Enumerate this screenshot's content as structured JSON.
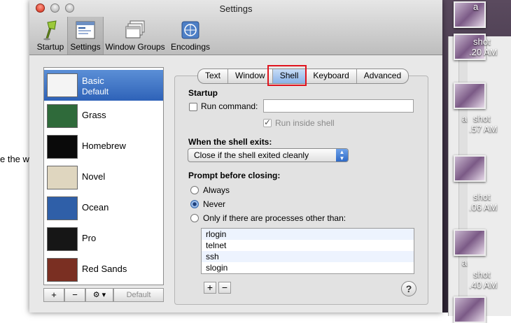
{
  "background": {
    "text": "e the w"
  },
  "desktop": {
    "labels": [
      {
        "line1": "shot",
        "line2": ".20 AM"
      },
      {
        "line1": "shot",
        "line2": ".57 AM"
      },
      {
        "line1": "shot",
        "line2": ".06 AM"
      },
      {
        "line1": "shot",
        "line2": ".40 AM"
      }
    ],
    "partial_1": "a",
    "partial_2": "a",
    "partial_3": "a"
  },
  "window": {
    "title": "Settings",
    "toolbar": [
      {
        "label": "Startup",
        "icon": "startup-icon"
      },
      {
        "label": "Settings",
        "icon": "settings-icon"
      },
      {
        "label": "Window Groups",
        "icon": "window-groups-icon"
      },
      {
        "label": "Encodings",
        "icon": "encodings-icon"
      }
    ]
  },
  "profiles": [
    {
      "name": "Basic",
      "sub": "Default"
    },
    {
      "name": "Grass"
    },
    {
      "name": "Homebrew"
    },
    {
      "name": "Novel"
    },
    {
      "name": "Ocean"
    },
    {
      "name": "Pro"
    },
    {
      "name": "Red Sands"
    }
  ],
  "profile_buttons": {
    "add": "+",
    "remove": "−",
    "action": "⚙ ▾",
    "default": "Default"
  },
  "tabs": [
    "Text",
    "Window",
    "Shell",
    "Keyboard",
    "Advanced"
  ],
  "shell": {
    "startup_heading": "Startup",
    "run_command_label": "Run command:",
    "run_command_value": "",
    "run_inside_shell_label": "Run inside shell",
    "exit_heading": "When the shell exits:",
    "exit_selected": "Close if the shell exited cleanly",
    "prompt_heading": "Prompt before closing:",
    "radio_always": "Always",
    "radio_never": "Never",
    "radio_only_if": "Only if there are processes other than:",
    "processes": [
      "rlogin",
      "telnet",
      "ssh",
      "slogin"
    ],
    "add": "+",
    "remove": "−",
    "help": "?"
  },
  "colors": {
    "accent": "#3a6fc4",
    "highlight_box": "#e0141e"
  }
}
